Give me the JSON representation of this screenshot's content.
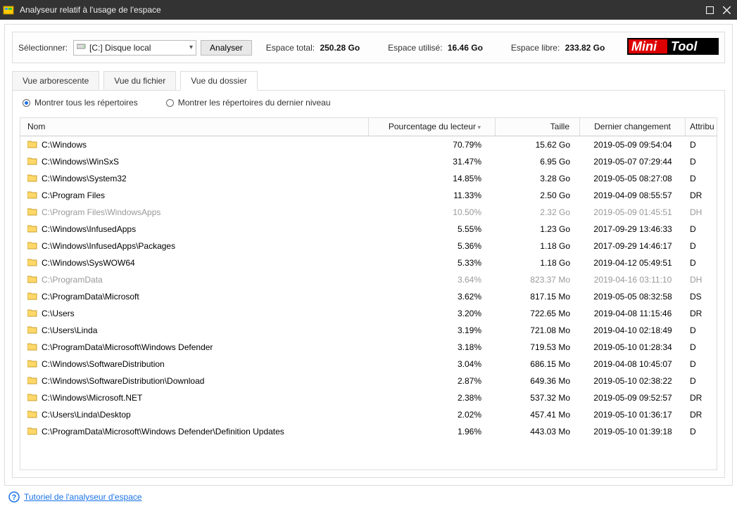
{
  "title": "Analyseur relatif à l'usage de l'espace",
  "toolbar": {
    "select_label": "Sélectionner:",
    "drive_value": "[C:] Disque local",
    "analyze_btn": "Analyser",
    "total_label": "Espace total:",
    "total_value": "250.28 Go",
    "used_label": "Espace utilisé:",
    "used_value": "16.46 Go",
    "free_label": "Espace libre:",
    "free_value": "233.82 Go",
    "logo_text_a": "Mini",
    "logo_text_b": "Tool"
  },
  "tabs": {
    "tree": "Vue arborescente",
    "file": "Vue du fichier",
    "folder": "Vue du dossier"
  },
  "radios": {
    "all": "Montrer tous les répertoires",
    "last": "Montrer les répertoires du dernier niveau"
  },
  "headers": {
    "name": "Nom",
    "pct": "Pourcentage du lecteur",
    "size": "Taille",
    "date": "Dernier changement",
    "attr": "Attribu"
  },
  "rows": [
    {
      "name": "C:\\Windows",
      "pct": "70.79%",
      "size": "15.62 Go",
      "date": "2019-05-09 09:54:04",
      "attr": "D",
      "dim": false
    },
    {
      "name": "C:\\Windows\\WinSxS",
      "pct": "31.47%",
      "size": "6.95 Go",
      "date": "2019-05-07 07:29:44",
      "attr": "D",
      "dim": false
    },
    {
      "name": "C:\\Windows\\System32",
      "pct": "14.85%",
      "size": "3.28 Go",
      "date": "2019-05-05 08:27:08",
      "attr": "D",
      "dim": false
    },
    {
      "name": "C:\\Program Files",
      "pct": "11.33%",
      "size": "2.50 Go",
      "date": "2019-04-09 08:55:57",
      "attr": "DR",
      "dim": false
    },
    {
      "name": "C:\\Program Files\\WindowsApps",
      "pct": "10.50%",
      "size": "2.32 Go",
      "date": "2019-05-09 01:45:51",
      "attr": "DH",
      "dim": true
    },
    {
      "name": "C:\\Windows\\InfusedApps",
      "pct": "5.55%",
      "size": "1.23 Go",
      "date": "2017-09-29 13:46:33",
      "attr": "D",
      "dim": false
    },
    {
      "name": "C:\\Windows\\InfusedApps\\Packages",
      "pct": "5.36%",
      "size": "1.18 Go",
      "date": "2017-09-29 14:46:17",
      "attr": "D",
      "dim": false
    },
    {
      "name": "C:\\Windows\\SysWOW64",
      "pct": "5.33%",
      "size": "1.18 Go",
      "date": "2019-04-12 05:49:51",
      "attr": "D",
      "dim": false
    },
    {
      "name": "C:\\ProgramData",
      "pct": "3.64%",
      "size": "823.37 Mo",
      "date": "2019-04-16 03:11:10",
      "attr": "DH",
      "dim": true
    },
    {
      "name": "C:\\ProgramData\\Microsoft",
      "pct": "3.62%",
      "size": "817.15 Mo",
      "date": "2019-05-05 08:32:58",
      "attr": "DS",
      "dim": false
    },
    {
      "name": "C:\\Users",
      "pct": "3.20%",
      "size": "722.65 Mo",
      "date": "2019-04-08 11:15:46",
      "attr": "DR",
      "dim": false
    },
    {
      "name": "C:\\Users\\Linda",
      "pct": "3.19%",
      "size": "721.08 Mo",
      "date": "2019-04-10 02:18:49",
      "attr": "D",
      "dim": false
    },
    {
      "name": "C:\\ProgramData\\Microsoft\\Windows Defender",
      "pct": "3.18%",
      "size": "719.53 Mo",
      "date": "2019-05-10 01:28:34",
      "attr": "D",
      "dim": false
    },
    {
      "name": "C:\\Windows\\SoftwareDistribution",
      "pct": "3.04%",
      "size": "686.15 Mo",
      "date": "2019-04-08 10:45:07",
      "attr": "D",
      "dim": false
    },
    {
      "name": "C:\\Windows\\SoftwareDistribution\\Download",
      "pct": "2.87%",
      "size": "649.36 Mo",
      "date": "2019-05-10 02:38:22",
      "attr": "D",
      "dim": false
    },
    {
      "name": "C:\\Windows\\Microsoft.NET",
      "pct": "2.38%",
      "size": "537.32 Mo",
      "date": "2019-05-09 09:52:57",
      "attr": "DR",
      "dim": false
    },
    {
      "name": "C:\\Users\\Linda\\Desktop",
      "pct": "2.02%",
      "size": "457.41 Mo",
      "date": "2019-05-10 01:36:17",
      "attr": "DR",
      "dim": false
    },
    {
      "name": "C:\\ProgramData\\Microsoft\\Windows Defender\\Definition Updates",
      "pct": "1.96%",
      "size": "443.03 Mo",
      "date": "2019-05-10 01:39:18",
      "attr": "D",
      "dim": false
    }
  ],
  "footer": {
    "link": "Tutoriel de l'analyseur d'espace"
  }
}
